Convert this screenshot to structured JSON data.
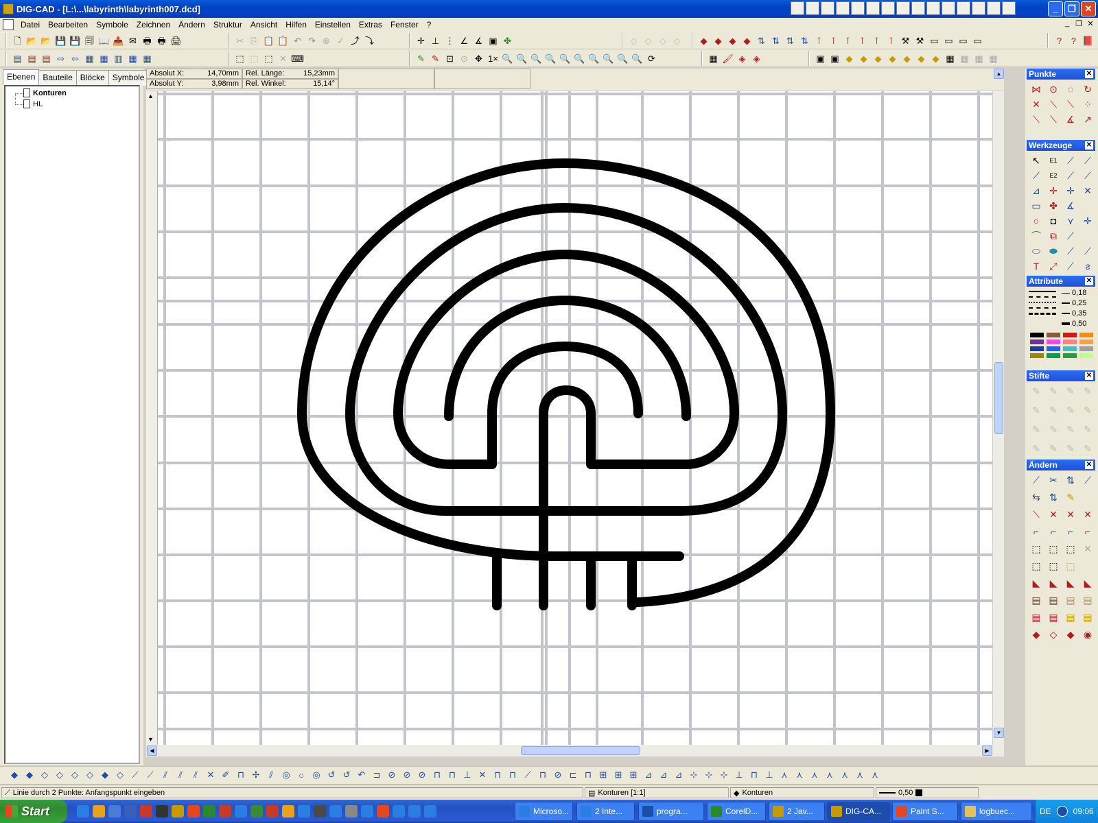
{
  "window": {
    "title": "DIG-CAD - [L:\\...\\labyrinth\\labyrinth007.dcd]",
    "controls": {
      "minimize": "_",
      "maximize": "❐",
      "close": "✕"
    }
  },
  "menu": {
    "items": [
      "Datei",
      "Bearbeiten",
      "Symbole",
      "Zeichnen",
      "Ändern",
      "Struktur",
      "Ansicht",
      "Hilfen",
      "Einstellen",
      "Extras",
      "Fenster",
      "?"
    ],
    "mdi_controls": [
      "_",
      "❐",
      "✕"
    ]
  },
  "left_panel": {
    "tabs": [
      "Ebenen",
      "Bauteile",
      "Blöcke",
      "Symbole"
    ],
    "active_tab": "Ebenen",
    "layers": [
      "Konturen",
      "HL"
    ]
  },
  "coordinates": {
    "absolut_x_label": "Absolut X:",
    "absolut_x_value": "14,70mm",
    "absolut_y_label": "Absolut Y:",
    "absolut_y_value": "3,98mm",
    "rel_laenge_label": "Rel. Länge:",
    "rel_laenge_value": "15,23mm",
    "rel_winkel_label": "Rel. Winkel:",
    "rel_winkel_value": "15,14°"
  },
  "palettes": {
    "punkte": "Punkte",
    "werkzeuge": "Werkzeuge",
    "attribute": "Attribute",
    "stifte": "Stifte",
    "aendern": "Ändern",
    "line_widths": [
      "0,18",
      "0,25",
      "0,35",
      "0,50"
    ],
    "swatch_colors": [
      "#000000",
      "#8b5a3c",
      "#e01010",
      "#ff8c00",
      "#7030a0",
      "#ff40ff",
      "#ff8080",
      "#ffa040",
      "#1a3aa0",
      "#2060ff",
      "#40c0c0",
      "#a0a0a0",
      "#9a8a00",
      "#00a050",
      "#20a040",
      "#c0ff80"
    ],
    "close_symbol": "✕"
  },
  "status": {
    "hint": "Linie durch 2 Punkte: Anfangspunkt eingeben",
    "layer": "Konturen [1:1]",
    "block": "Konturen",
    "line_width": "0,50"
  },
  "taskbar": {
    "start_label": "Start",
    "tasks": [
      "Microso...",
      "2 Inte...",
      "progra...",
      "CorelD...",
      "2 Jav...",
      "DIG-CA...",
      "Paint S...",
      "logbuec..."
    ],
    "active_task": "DIG-CA...",
    "language": "DE",
    "clock": "09:06"
  },
  "drawing": {
    "grid_color": "#c4c4cc",
    "stroke_color": "#000000"
  }
}
